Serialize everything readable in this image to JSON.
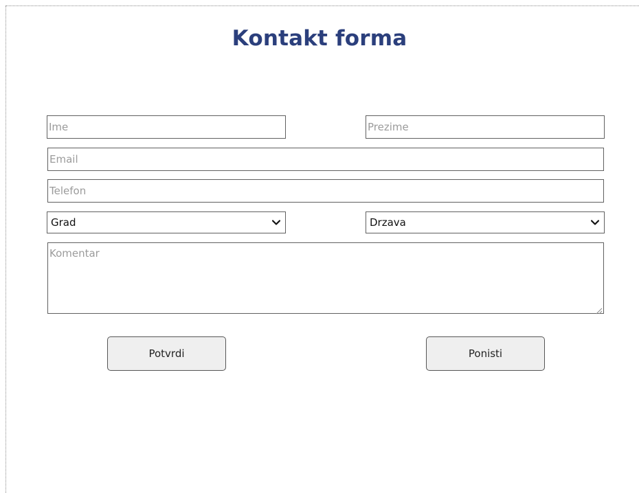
{
  "form": {
    "title": "Kontakt forma",
    "fields": {
      "first_name": {
        "placeholder": "Ime",
        "value": ""
      },
      "last_name": {
        "placeholder": "Prezime",
        "value": ""
      },
      "email": {
        "placeholder": "Email",
        "value": ""
      },
      "phone": {
        "placeholder": "Telefon",
        "value": ""
      },
      "comment": {
        "placeholder": "Komentar",
        "value": ""
      }
    },
    "selects": {
      "city": {
        "selected": "Grad",
        "icon": "chevron-down-icon"
      },
      "country": {
        "selected": "Drzava",
        "icon": "chevron-down-icon"
      }
    },
    "buttons": {
      "submit": "Potvrdi",
      "reset": "Ponisti"
    }
  },
  "colors": {
    "title": "#2b3f7c",
    "border": "#5f5f5f",
    "placeholder": "#9b9b9b",
    "button_bg": "#efefef"
  }
}
